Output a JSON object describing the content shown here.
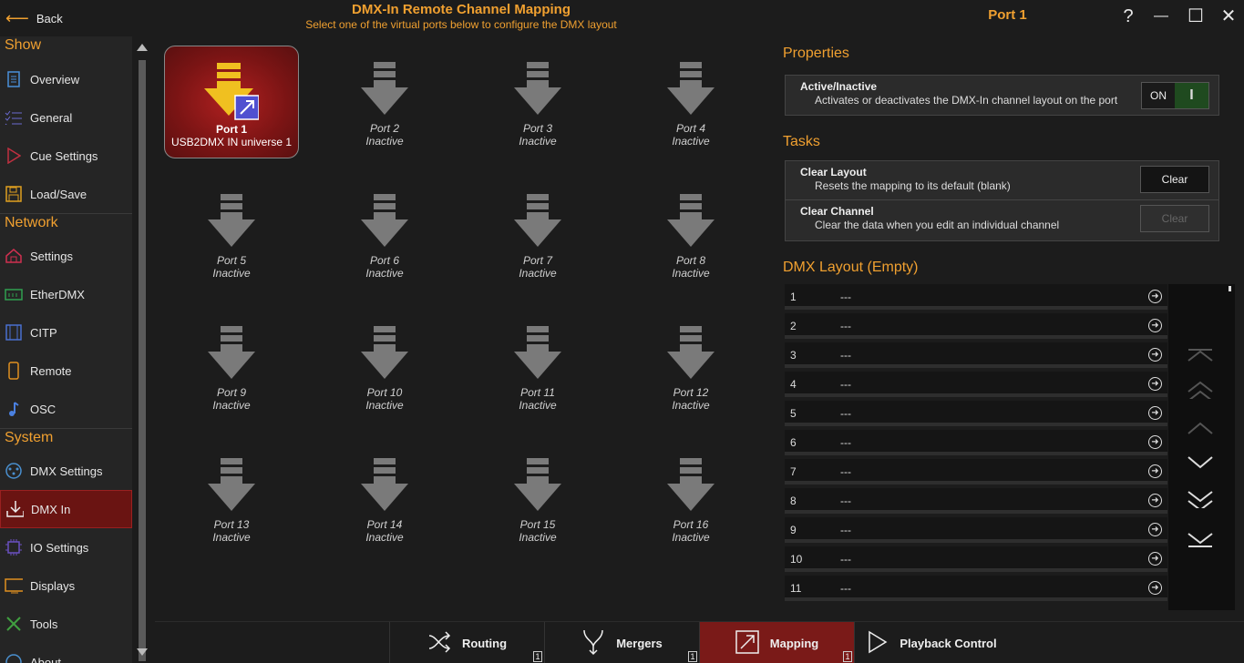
{
  "header": {
    "back_label": "Back",
    "title": "DMX-In Remote Channel Mapping",
    "subtitle": "Select one of the virtual ports below to configure the DMX layout"
  },
  "right_header": {
    "title": "Port 1",
    "help": "?",
    "minimize": "—",
    "maximize": "☐",
    "close": "✕"
  },
  "sidebar": {
    "sections": [
      {
        "title": "Show",
        "items": [
          {
            "label": "Overview",
            "icon": "document-icon",
            "active": false
          },
          {
            "label": "General",
            "icon": "checklist-icon",
            "active": false
          },
          {
            "label": "Cue Settings",
            "icon": "play-icon",
            "active": false
          },
          {
            "label": "Load/Save",
            "icon": "floppy-icon",
            "active": false
          }
        ]
      },
      {
        "title": "Network",
        "items": [
          {
            "label": "Settings",
            "icon": "network-icon",
            "active": false
          },
          {
            "label": "EtherDMX",
            "icon": "ethernet-icon",
            "active": false
          },
          {
            "label": "CITP",
            "icon": "film-icon",
            "active": false
          },
          {
            "label": "Remote",
            "icon": "phone-icon",
            "active": false
          },
          {
            "label": "OSC",
            "icon": "music-note-icon",
            "active": false
          }
        ]
      },
      {
        "title": "System",
        "items": [
          {
            "label": "DMX Settings",
            "icon": "xlr-icon",
            "active": false
          },
          {
            "label": "DMX In",
            "icon": "download-icon",
            "active": true
          },
          {
            "label": "IO Settings",
            "icon": "chip-icon",
            "active": false
          },
          {
            "label": "Displays",
            "icon": "monitor-icon",
            "active": false
          },
          {
            "label": "Tools",
            "icon": "tools-icon",
            "active": false
          },
          {
            "label": "About",
            "icon": "info-icon",
            "active": false
          }
        ]
      }
    ]
  },
  "ports": [
    {
      "name": "Port 1",
      "status": "USB2DMX IN universe 1",
      "selected": true
    },
    {
      "name": "Port 2",
      "status": "Inactive"
    },
    {
      "name": "Port 3",
      "status": "Inactive"
    },
    {
      "name": "Port 4",
      "status": "Inactive"
    },
    {
      "name": "Port 5",
      "status": "Inactive"
    },
    {
      "name": "Port 6",
      "status": "Inactive"
    },
    {
      "name": "Port 7",
      "status": "Inactive"
    },
    {
      "name": "Port 8",
      "status": "Inactive"
    },
    {
      "name": "Port 9",
      "status": "Inactive"
    },
    {
      "name": "Port 10",
      "status": "Inactive"
    },
    {
      "name": "Port 11",
      "status": "Inactive"
    },
    {
      "name": "Port 12",
      "status": "Inactive"
    },
    {
      "name": "Port 13",
      "status": "Inactive"
    },
    {
      "name": "Port 14",
      "status": "Inactive"
    },
    {
      "name": "Port 15",
      "status": "Inactive"
    },
    {
      "name": "Port 16",
      "status": "Inactive"
    }
  ],
  "properties": {
    "heading": "Properties",
    "active_title": "Active/Inactive",
    "active_desc": "Activates or deactivates the DMX-In channel layout on the port",
    "toggle_label": "ON",
    "toggle_mark": "I"
  },
  "tasks": {
    "heading": "Tasks",
    "clear_layout_title": "Clear Layout",
    "clear_layout_desc": "Resets the mapping to its default (blank)",
    "clear_layout_btn": "Clear",
    "clear_channel_title": "Clear Channel",
    "clear_channel_desc": "Clear the data when you edit an individual channel",
    "clear_channel_btn": "Clear"
  },
  "dmx_layout": {
    "heading": "DMX Layout (Empty)",
    "rows": [
      {
        "n": "1",
        "v": "---"
      },
      {
        "n": "2",
        "v": "---"
      },
      {
        "n": "3",
        "v": "---"
      },
      {
        "n": "4",
        "v": "---"
      },
      {
        "n": "5",
        "v": "---"
      },
      {
        "n": "6",
        "v": "---"
      },
      {
        "n": "7",
        "v": "---"
      },
      {
        "n": "8",
        "v": "---"
      },
      {
        "n": "9",
        "v": "---"
      },
      {
        "n": "10",
        "v": "---"
      },
      {
        "n": "11",
        "v": "---"
      }
    ]
  },
  "tabs": [
    {
      "label": "Routing",
      "icon": "shuffle-icon",
      "badge": "1",
      "active": false
    },
    {
      "label": "Mergers",
      "icon": "merge-icon",
      "badge": "1",
      "active": false
    },
    {
      "label": "Mapping",
      "icon": "mapping-icon",
      "badge": "1",
      "active": true
    },
    {
      "label": "Playback Control",
      "icon": "play-icon",
      "active": false
    }
  ],
  "colors": {
    "accent": "#f0a030",
    "active_red": "#7a1a18",
    "toggle_green": "#1f4a1f"
  }
}
